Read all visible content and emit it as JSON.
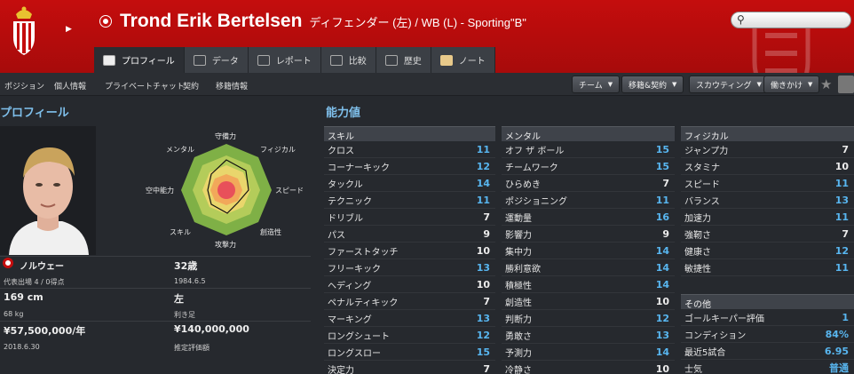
{
  "header": {
    "player_name": "Trond Erik Bertelsen",
    "player_sub": "ディフェンダー (左) / WB (L) - Sporting\"B\"",
    "search_placeholder": ""
  },
  "tabs": [
    {
      "label": "プロフィール",
      "icon": "profile-icon"
    },
    {
      "label": "データ",
      "icon": "stats-icon"
    },
    {
      "label": "レポート",
      "icon": "report-icon"
    },
    {
      "label": "比較",
      "icon": "compare-icon"
    },
    {
      "label": "歴史",
      "icon": "history-icon"
    },
    {
      "label": "ノート",
      "icon": "notes-icon"
    }
  ],
  "subnav": {
    "links": [
      "ポジション",
      "個人情報",
      "プライベートチャット",
      "契約",
      "移籍情報"
    ],
    "buttons": [
      "チーム",
      "移籍&契約",
      "スカウティング",
      "働きかけ"
    ]
  },
  "profile": {
    "title": "プロフィール",
    "radar_labels": [
      "守備力",
      "フィジカル",
      "スピード",
      "創造性",
      "攻撃力",
      "スキル",
      "空中能力",
      "メンタル"
    ],
    "nationality": "ノルウェー",
    "caps": "代表出場 4 / 0得点",
    "age": "32歳",
    "dob": "1984.6.5",
    "height": "169 cm",
    "foot": "左",
    "weight": "68 kg",
    "foot_label": "利き足",
    "wage": "¥57,500,000/年",
    "value": "¥140,000,000",
    "contract": "2018.6.30",
    "value_label": "推定評価額"
  },
  "attributes": {
    "title": "能力値",
    "skill": {
      "header": "スキル",
      "rows": [
        {
          "name": "クロス",
          "value": "11"
        },
        {
          "name": "コーナーキック",
          "value": "12"
        },
        {
          "name": "タックル",
          "value": "14"
        },
        {
          "name": "テクニック",
          "value": "11"
        },
        {
          "name": "ドリブル",
          "value": "7"
        },
        {
          "name": "パス",
          "value": "9"
        },
        {
          "name": "ファーストタッチ",
          "value": "10"
        },
        {
          "name": "フリーキック",
          "value": "13"
        },
        {
          "name": "ヘディング",
          "value": "10"
        },
        {
          "name": "ペナルティキック",
          "value": "7"
        },
        {
          "name": "マーキング",
          "value": "13"
        },
        {
          "name": "ロングシュート",
          "value": "12"
        },
        {
          "name": "ロングスロー",
          "value": "15"
        },
        {
          "name": "決定力",
          "value": "7"
        }
      ]
    },
    "mental": {
      "header": "メンタル",
      "rows": [
        {
          "name": "オフ ザ ボール",
          "value": "15"
        },
        {
          "name": "チームワーク",
          "value": "15"
        },
        {
          "name": "ひらめき",
          "value": "7"
        },
        {
          "name": "ポジショニング",
          "value": "11"
        },
        {
          "name": "運動量",
          "value": "16"
        },
        {
          "name": "影響力",
          "value": "9"
        },
        {
          "name": "集中力",
          "value": "14"
        },
        {
          "name": "勝利意欲",
          "value": "14"
        },
        {
          "name": "積極性",
          "value": "14"
        },
        {
          "name": "創造性",
          "value": "10"
        },
        {
          "name": "判断力",
          "value": "12"
        },
        {
          "name": "勇敢さ",
          "value": "13"
        },
        {
          "name": "予測力",
          "value": "14"
        },
        {
          "name": "冷静さ",
          "value": "10"
        }
      ]
    },
    "physical": {
      "header": "フィジカル",
      "rows": [
        {
          "name": "ジャンプ力",
          "value": "7"
        },
        {
          "name": "スタミナ",
          "value": "10"
        },
        {
          "name": "スピード",
          "value": "11"
        },
        {
          "name": "バランス",
          "value": "13"
        },
        {
          "name": "加速力",
          "value": "11"
        },
        {
          "name": "強靭さ",
          "value": "7"
        },
        {
          "name": "健康さ",
          "value": "12"
        },
        {
          "name": "敏捷性",
          "value": "11"
        }
      ]
    },
    "other": {
      "header": "その他",
      "rows": [
        {
          "name": "ゴールキーパー評価",
          "value": "1"
        },
        {
          "name": "コンディション",
          "value": "84%"
        },
        {
          "name": "最近5試合",
          "value": "6.95"
        },
        {
          "name": "士気",
          "value": "普通"
        }
      ]
    }
  },
  "colors": {
    "accent": "#c40d0d",
    "title_blue": "#7fc0ec",
    "value_blue": "#58b6f0"
  }
}
